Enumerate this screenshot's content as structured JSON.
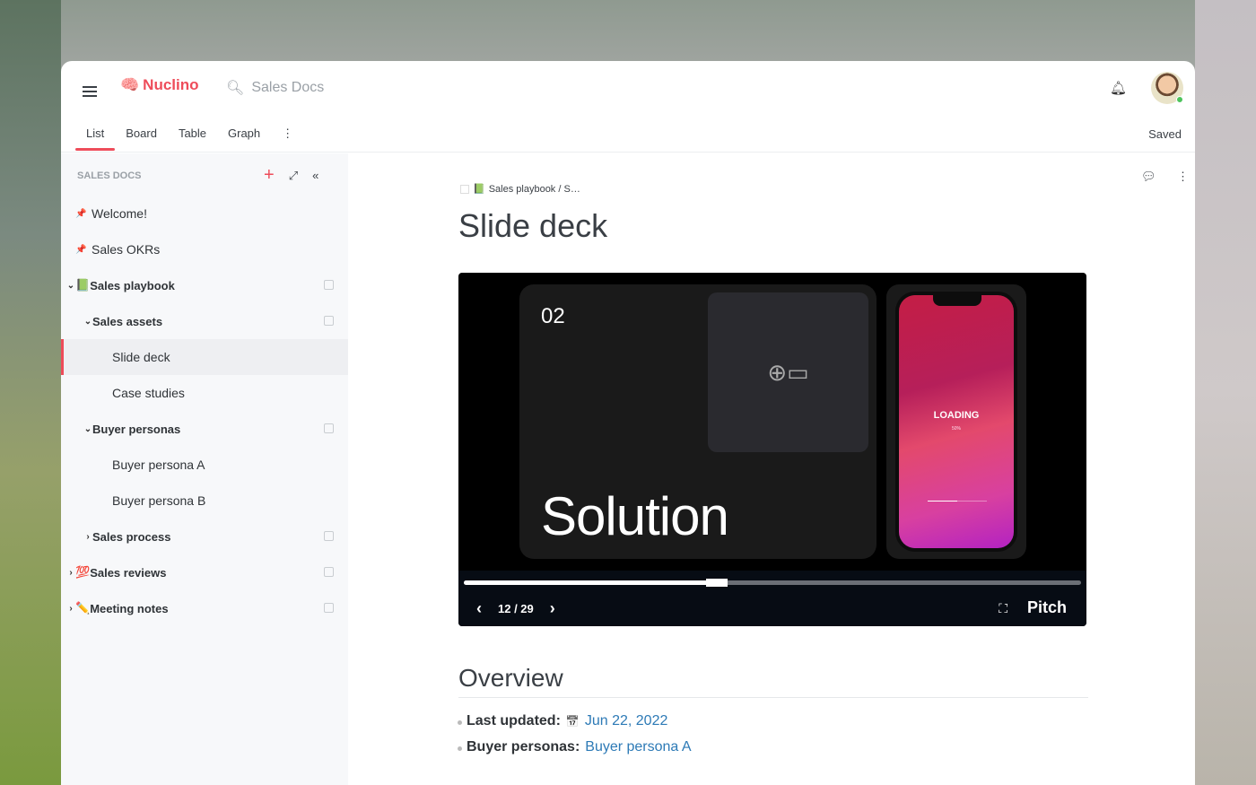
{
  "app": {
    "name": "Nuclino",
    "search_placeholder": "Sales Docs",
    "status": "Saved"
  },
  "tabs": [
    {
      "label": "List"
    },
    {
      "label": "Board"
    },
    {
      "label": "Table"
    },
    {
      "label": "Graph"
    }
  ],
  "sidebar": {
    "header": "SALES DOCS",
    "items": [
      {
        "label": "Welcome!",
        "icon": "📌"
      },
      {
        "label": "Sales OKRs",
        "icon": "📌"
      },
      {
        "label": "Sales playbook",
        "icon": "📗"
      },
      {
        "label": "Sales assets"
      },
      {
        "label": "Slide deck"
      },
      {
        "label": "Case studies"
      },
      {
        "label": "Buyer personas"
      },
      {
        "label": "Buyer persona A"
      },
      {
        "label": "Buyer persona B"
      },
      {
        "label": "Sales process"
      },
      {
        "label": "Sales reviews",
        "icon": "💯"
      },
      {
        "label": "Meeting notes",
        "icon": "✏️"
      }
    ]
  },
  "doc": {
    "breadcrumb": "Sales playbook / S…",
    "breadcrumb_icon": "📗",
    "title": "Slide deck",
    "embed": {
      "slide_number": "02",
      "slide_title": "Solution",
      "phone_text": "LOADING",
      "phone_percent": "50%",
      "page": "12 / 29",
      "progress": 0.41,
      "brand": "Pitch"
    },
    "overview_heading": "Overview",
    "fields": [
      {
        "label": "Last updated:",
        "value": "Jun 22, 2022",
        "icon": "📅"
      },
      {
        "label": "Buyer personas:",
        "value": "Buyer persona A"
      }
    ]
  },
  "colors": {
    "accent": "#ee4c5a",
    "link": "#2d7ab6"
  }
}
